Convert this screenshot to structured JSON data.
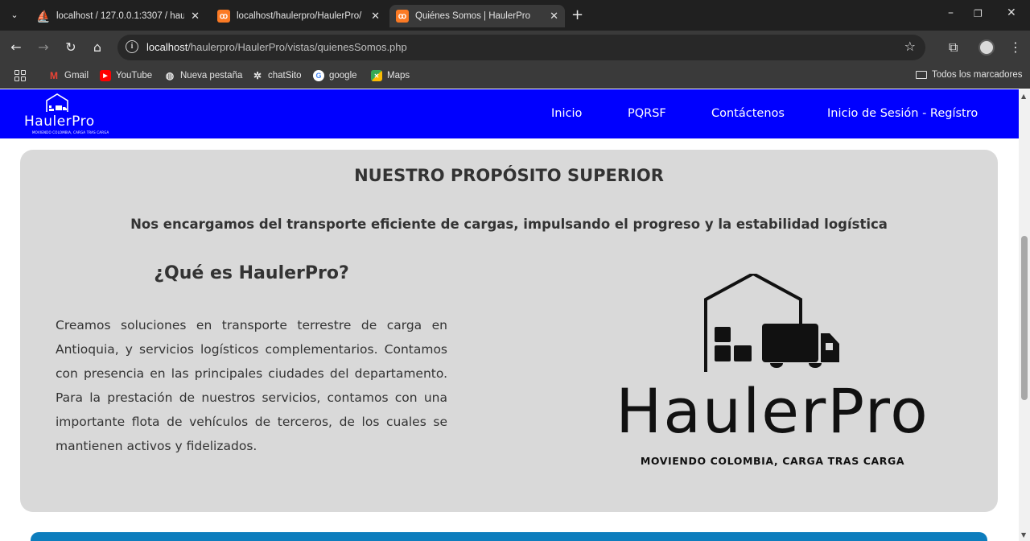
{
  "browser": {
    "tabs": [
      {
        "title": "localhost / 127.0.0.1:3307 / hau",
        "close": "✕",
        "active": false,
        "favicon_color": "#f29111"
      },
      {
        "title": "localhost/haulerpro/HaulerPro/",
        "close": "✕",
        "active": false,
        "favicon_color": "#fb7a24"
      },
      {
        "title": "Quiénes Somos | HaulerPro",
        "close": "✕",
        "active": true,
        "favicon_color": "#fb7a24"
      }
    ],
    "url_host": "localhost",
    "url_path": "/haulerpro/HaulerPro/vistas/quienesSomos.php",
    "bookmarks": [
      {
        "label": "Gmail",
        "icon": "gmail-icon",
        "color": "#ea4335"
      },
      {
        "label": "YouTube",
        "icon": "youtube-icon",
        "color": "#ff0000"
      },
      {
        "label": "Nueva pestaña",
        "icon": "globe-icon",
        "color": "#5f6368"
      },
      {
        "label": "chatSito",
        "icon": "openai-icon",
        "color": "#5f6368"
      },
      {
        "label": "google",
        "icon": "google-icon",
        "color": "#4285f4"
      },
      {
        "label": "Maps",
        "icon": "maps-icon",
        "color": "#34a853"
      }
    ],
    "all_bookmarks": "Todos los marcadores"
  },
  "site": {
    "brand": "HaulerPro",
    "brand_tagline": "MOVIENDO COLOMBIA, CARGA TRAS CARGA",
    "nav": [
      "Inicio",
      "PQRSF",
      "Contáctenos",
      "Inicio de Sesión - Regístro"
    ],
    "nav_color": "#0000ff"
  },
  "main": {
    "title": "NUESTRO PROPÓSITO SUPERIOR",
    "subtitle": "Nos encargamos del transporte eficiente de cargas, impulsando el progreso y la estabilidad logística",
    "what_title": "¿Qué es HaulerPro?",
    "what_text": "Creamos soluciones en transporte terrestre de carga en Antioquia, y servicios logísticos complementarios. Contamos con presencia en las principales ciudades del departamento. Para la prestación de nuestros servicios, contamos con una importante flota de vehículos de terceros, de los cuales se mantienen activos y fidelizados.",
    "logo_word": "HaulerPro",
    "logo_tagline": "MOVIENDO COLOMBIA, CARGA TRAS CARGA"
  }
}
